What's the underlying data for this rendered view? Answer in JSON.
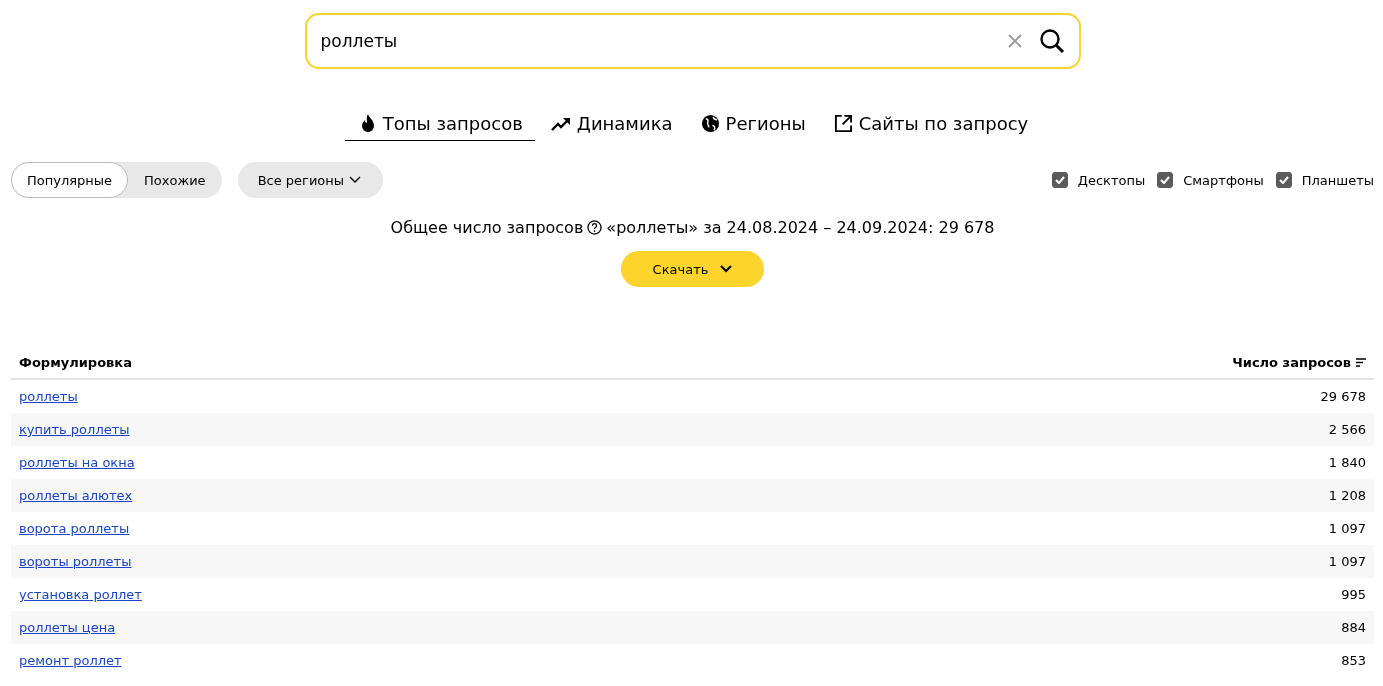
{
  "search": {
    "value": "роллеты"
  },
  "tabs": [
    {
      "kind": "tops",
      "label": "Топы запросов",
      "selected": true
    },
    {
      "kind": "dynamics",
      "label": "Динамика",
      "selected": false
    },
    {
      "kind": "regions",
      "label": "Регионы",
      "selected": false
    },
    {
      "kind": "sites",
      "label": "Сайты по запросу",
      "selected": false
    }
  ],
  "mode_switch": [
    {
      "label": "Популярные",
      "selected": true
    },
    {
      "label": "Похожие",
      "selected": false
    }
  ],
  "region_dropdown": {
    "label": "Все регионы"
  },
  "devices": [
    {
      "label": "Десктопы",
      "checked": true
    },
    {
      "label": "Смартфоны",
      "checked": true
    },
    {
      "label": "Планшеты",
      "checked": true
    }
  ],
  "summary": {
    "label": "Общее число запросов",
    "text": "«роллеты» за 24.08.2024 – 24.09.2024: 29 678"
  },
  "download_button": {
    "label": "Скачать"
  },
  "table": {
    "columns": [
      "Формулировка",
      "Число запросов"
    ],
    "rows": [
      [
        "роллеты",
        "29 678"
      ],
      [
        "купить роллеты",
        "2 566"
      ],
      [
        "роллеты на окна",
        "1 840"
      ],
      [
        "роллеты алютех",
        "1 208"
      ],
      [
        "ворота роллеты",
        "1 097"
      ],
      [
        "вороты роллеты",
        "1 097"
      ],
      [
        "установка роллет",
        "995"
      ],
      [
        "роллеты цена",
        "884"
      ],
      [
        "ремонт роллет",
        "853"
      ]
    ]
  }
}
